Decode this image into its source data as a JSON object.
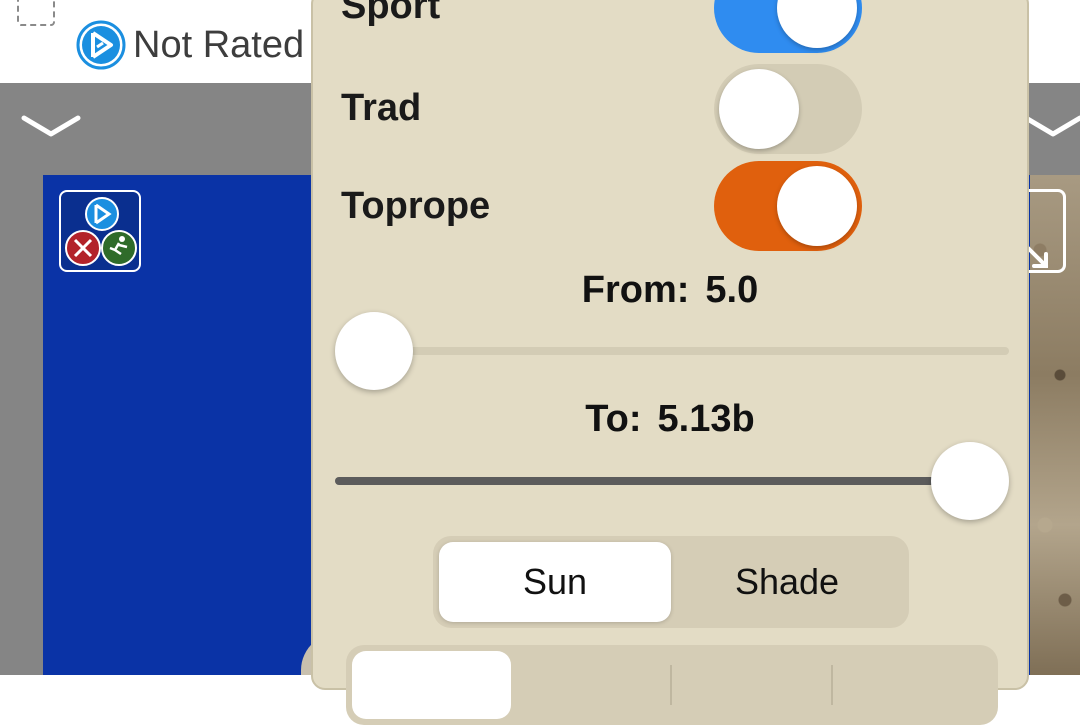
{
  "header": {
    "rating_label": "Not Rated"
  },
  "filters": {
    "sport": {
      "label": "Sport",
      "enabled": true
    },
    "trad": {
      "label": "Trad",
      "enabled": false
    },
    "toprope": {
      "label": "Toprope",
      "enabled": true
    },
    "from": {
      "label": "From:",
      "value": "5.0"
    },
    "to": {
      "label": "To:",
      "value": "5.13b"
    },
    "exposure": {
      "options": [
        "Sun",
        "Shade"
      ],
      "selected": "Sun"
    }
  },
  "colors": {
    "toggle_sport": "#2f8cf0",
    "toggle_toprope": "#e0600d",
    "panel_bg": "#e3dcc5",
    "photo_sky": "#0a33a6"
  },
  "icons": {
    "select": "dashed-square-icon",
    "rating": "mountain-project-logo-icon",
    "collapse": "chevron-down-icon",
    "expand": "expand-arrow-icon",
    "type_badge": "route-type-badge-icon"
  }
}
